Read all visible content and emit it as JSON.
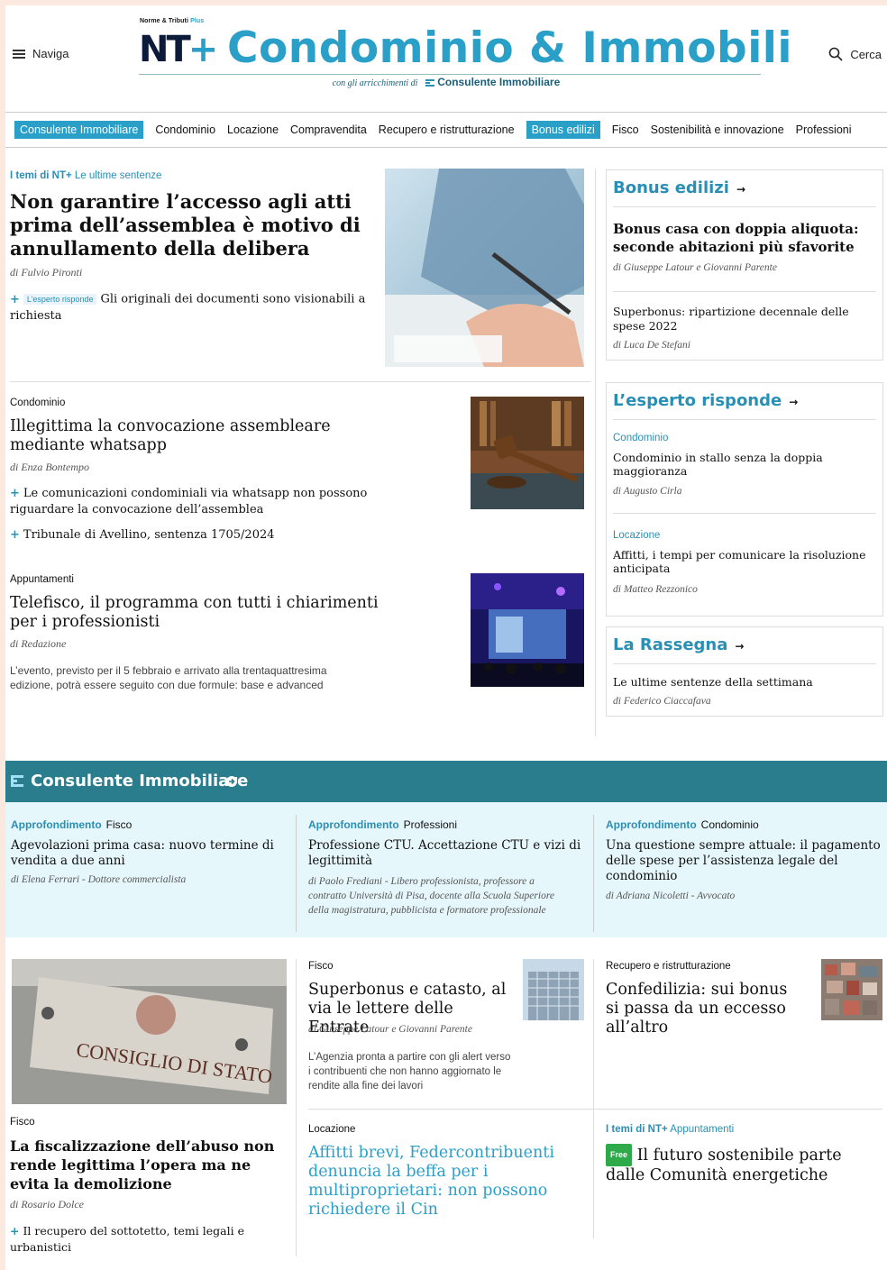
{
  "header": {
    "menu_label": "Naviga",
    "search_label": "Cerca",
    "logo_small": "Norme & Tributi",
    "logo_small_plus": "Plus",
    "logo_nt": "NT",
    "logo_title": "Condominio & Immobili",
    "arricchimenti": "con gli arricchimenti di",
    "arricchimenti_brand": "Consulente Immobiliare"
  },
  "nav": {
    "items": [
      "Consulente Immobiliare",
      "Condominio",
      "Locazione",
      "Compravendita",
      "Recupero e ristrutturazione",
      "Bonus edilizi",
      "Fisco",
      "Sostenibilità e innovazione",
      "Professioni"
    ]
  },
  "lead": {
    "tem": "I temi di NT+",
    "sub": "Le ultime sentenze",
    "title": "Non garantire l’accesso agli atti prima dell’assemblea è motivo di annullamento della delibera",
    "byline": "di Fulvio Pironti",
    "tag": "L’esperto risponde",
    "bullet": "Gli originali dei documenti sono visionabili a richiesta"
  },
  "story2": {
    "kicker": "Condominio",
    "title": "Illegittima la convocazione assembleare mediante whatsapp",
    "byline": "di Enza Bontempo",
    "bullet1": "Le comunicazioni condominiali via whatsapp non possono riguardare la convocazione dell’assemblea",
    "bullet2": "Tribunale di Avellino, sentenza 1705/2024"
  },
  "story3": {
    "kicker": "Appuntamenti",
    "title": "Telefisco, il programma con tutti i chiarimenti per i professionisti",
    "byline": "di Redazione",
    "summary": "L’evento, previsto per il 5 febbraio e arrivato alla trentaquattresima edizione, potrà essere seguito con due formule: base e advanced"
  },
  "bonus_box": {
    "head": "Bonus edilizi",
    "a1_title": "Bonus casa con doppia aliquota: seconde abitazioni più sfavorite",
    "a1_byline": "di Giuseppe Latour e Giovanni Parente",
    "a2_title": "Superbonus: ripartizione decennale delle spese 2022",
    "a2_byline": "di Luca De Stefani"
  },
  "esperto_box": {
    "head": "L’esperto risponde",
    "a1_kicker": "Condominio",
    "a1_title": "Condominio in stallo senza la doppia maggioranza",
    "a1_byline": "di Augusto Cirla",
    "a2_kicker": "Locazione",
    "a2_title": "Affitti, i tempi per comunicare la risoluzione anticipata",
    "a2_byline": "di Matteo Rezzonico"
  },
  "rassegna_box": {
    "head": "La Rassegna",
    "a1_title": "Le ultime sentenze della settimana",
    "a1_byline": "di Federico Ciaccafava"
  },
  "ci_section": {
    "title": "Consulente Immobiliare",
    "c1_label": "Approfondimento",
    "c1_cat": "Fisco",
    "c1_title": "Agevolazioni prima casa: nuovo termine di vendita a due anni",
    "c1_byline": "di Elena Ferrari - Dottore commercialista",
    "c2_label": "Approfondimento",
    "c2_cat": "Professioni",
    "c2_title": "Professione CTU. Accettazione CTU e vizi di legittimità",
    "c2_byline": "di Paolo Frediani - Libero professionista, professore a contratto Università di Pisa, docente alla Scuola Superiore della magistratura, pubblicista e formatore professionale",
    "c3_label": "Approfondimento",
    "c3_cat": "Condominio",
    "c3_title": "Una questione sempre attuale: il pagamento delle spese per l’assistenza legale del condominio",
    "c3_byline": "di Adriana Nicoletti - Avvocato"
  },
  "bottom": {
    "b1_sign": "CONSIGLIO DI STATO",
    "b1_kicker": "Fisco",
    "b1_title": "La fiscalizzazione dell’abuso non rende legittima l’opera ma ne evita la demolizione",
    "b1_byline": "di Rosario Dolce",
    "b1_bullet": "Il recupero del sottotetto, temi legali e urbanistici",
    "b2_kicker": "Fisco",
    "b2_title": "Superbonus e catasto, al via le lettere delle Entrate",
    "b2_byline": "di Giuseppe Latour e Giovanni Parente",
    "b2_summary": "L’Agenzia pronta a partire con gli alert verso i contribuenti che non hanno aggiornato le rendite alla fine dei lavori",
    "b3_kicker": "Recupero e ristrutturazione",
    "b3_title": "Confedilizia: sui bonus si passa da un eccesso all’altro",
    "b4_kicker": "Locazione",
    "b4_title": "Affitti brevi, Federcontribuenti denuncia la beffa per i multiproprietari: non possono richiedere il Cin",
    "b5_tem": "I temi di NT+",
    "b5_sub": "Appuntamenti",
    "b5_badge": "Free",
    "b5_title": "Il futuro sostenibile parte dalle Comunità energetiche"
  },
  "colors": {
    "accent": "#2aa0c9",
    "ci_band": "#2a7d8c",
    "ci_bg": "#e6f7fc",
    "page_bg": "#fbe9df"
  }
}
